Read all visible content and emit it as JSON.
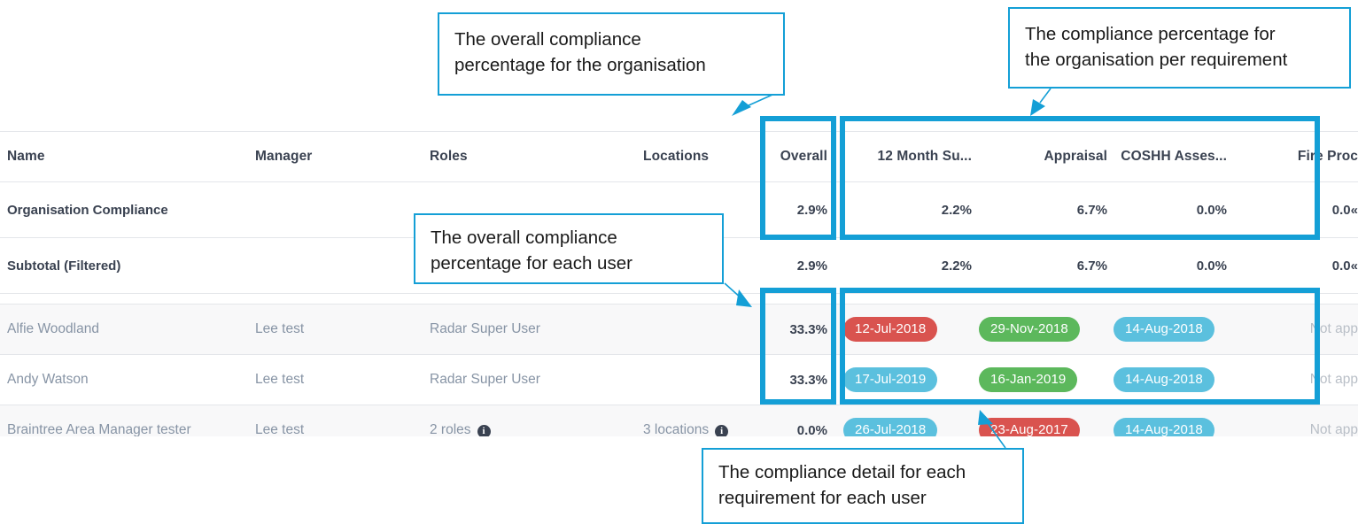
{
  "table": {
    "columns": [
      {
        "key": "name",
        "label": "Name"
      },
      {
        "key": "manager",
        "label": "Manager"
      },
      {
        "key": "roles",
        "label": "Roles"
      },
      {
        "key": "loc",
        "label": "Locations"
      },
      {
        "key": "overall",
        "label": "Overall"
      },
      {
        "key": "r0",
        "label": "12 Month Su..."
      },
      {
        "key": "r1",
        "label": "Appraisal"
      },
      {
        "key": "r2",
        "label": "COSHH Asses..."
      },
      {
        "key": "r3",
        "label": "Fire Proc"
      }
    ],
    "summary_rows": [
      {
        "label": "Organisation Compliance",
        "overall": "2.9%",
        "values": [
          "2.2%",
          "6.7%",
          "0.0%",
          "0.0«"
        ]
      },
      {
        "label": "Subtotal (Filtered)",
        "overall": "2.9%",
        "values": [
          "2.2%",
          "6.7%",
          "0.0%",
          "0.0«"
        ]
      }
    ],
    "user_rows": [
      {
        "name": "Alfie Woodland",
        "manager": "Lee test",
        "roles": "Radar Super User",
        "roles_icon": false,
        "locations": "",
        "locations_icon": false,
        "overall": "33.3%",
        "cells": [
          {
            "text": "12-Jul-2018",
            "style": "red"
          },
          {
            "text": "29-Nov-2018",
            "style": "green"
          },
          {
            "text": "14-Aug-2018",
            "style": "blue"
          },
          {
            "text": "Not app",
            "style": "na"
          }
        ]
      },
      {
        "name": "Andy Watson",
        "manager": "Lee test",
        "roles": "Radar Super User",
        "roles_icon": false,
        "locations": "",
        "locations_icon": false,
        "overall": "33.3%",
        "cells": [
          {
            "text": "17-Jul-2019",
            "style": "blue"
          },
          {
            "text": "16-Jan-2019",
            "style": "green"
          },
          {
            "text": "14-Aug-2018",
            "style": "blue"
          },
          {
            "text": "Not app",
            "style": "na"
          }
        ]
      },
      {
        "name": "Braintree Area Manager tester",
        "manager": "Lee test",
        "roles": "2 roles",
        "roles_icon": true,
        "locations": "3 locations",
        "locations_icon": true,
        "overall": "0.0%",
        "cells": [
          {
            "text": "26-Jul-2018",
            "style": "blue"
          },
          {
            "text": "23-Aug-2017",
            "style": "red"
          },
          {
            "text": "14-Aug-2018",
            "style": "blue"
          },
          {
            "text": "Not app",
            "style": "na"
          }
        ]
      }
    ]
  },
  "callouts": {
    "org_overall": {
      "line1": "The overall compliance",
      "line2": "percentage for the organisation"
    },
    "org_req": {
      "line1": "The compliance percentage for",
      "line2": "the organisation per requirement"
    },
    "user_overall": {
      "line1": "The overall compliance",
      "line2": "percentage for each user"
    },
    "detail": {
      "line1": "The compliance detail for each",
      "line2": "requirement for each user"
    }
  },
  "colors": {
    "accent": "#149fd6",
    "overdue": "#d9534f",
    "compliant": "#5cb85c",
    "due": "#5bc0de",
    "header_text": "#3a4251",
    "body_text": "#8794a5",
    "na_text": "#b9bfc7"
  },
  "icons": {
    "info": "i"
  }
}
